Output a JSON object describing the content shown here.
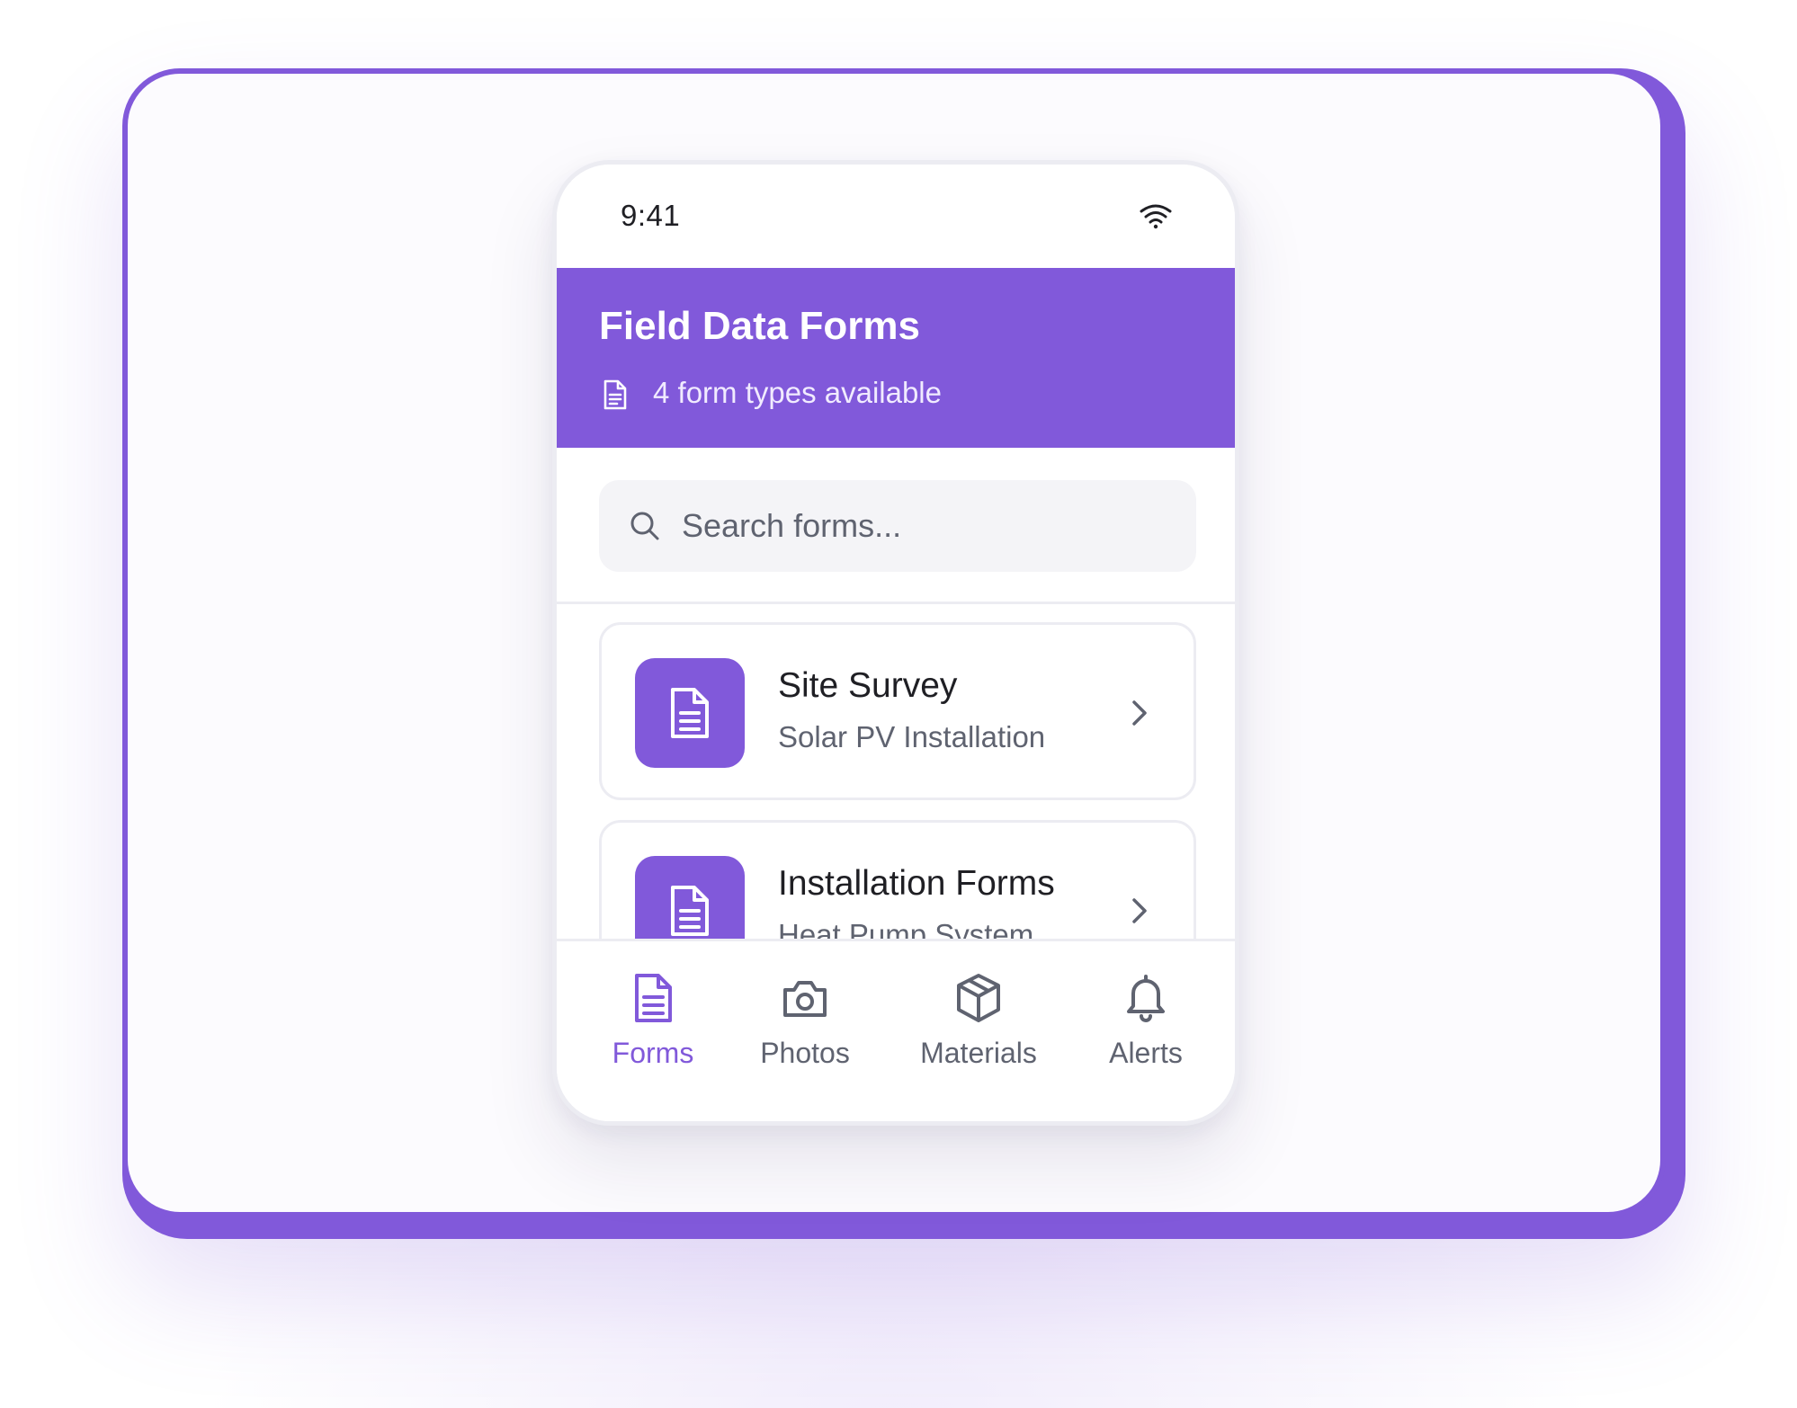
{
  "status_bar": {
    "time": "9:41",
    "wifi_icon": "wifi-icon"
  },
  "header": {
    "title": "Field Data Forms",
    "subtitle": "4 form types available",
    "subtitle_icon": "document-icon"
  },
  "search": {
    "placeholder": "Search forms...",
    "value": "",
    "icon": "search-icon"
  },
  "forms": [
    {
      "title": "Site Survey",
      "subtitle": "Solar PV Installation",
      "icon": "document-icon"
    },
    {
      "title": "Installation Forms",
      "subtitle": "Heat Pump System",
      "icon": "document-icon"
    }
  ],
  "bottom_nav": {
    "items": [
      {
        "label": "Forms",
        "icon": "document-icon",
        "active": true
      },
      {
        "label": "Photos",
        "icon": "camera-icon",
        "active": false
      },
      {
        "label": "Materials",
        "icon": "package-icon",
        "active": false
      },
      {
        "label": "Alerts",
        "icon": "bell-icon",
        "active": false
      }
    ]
  },
  "colors": {
    "accent": "#8159da",
    "text_primary": "#1f1f24",
    "text_secondary": "#5f6370",
    "border": "#ececf2",
    "search_bg": "#f4f4f7"
  }
}
